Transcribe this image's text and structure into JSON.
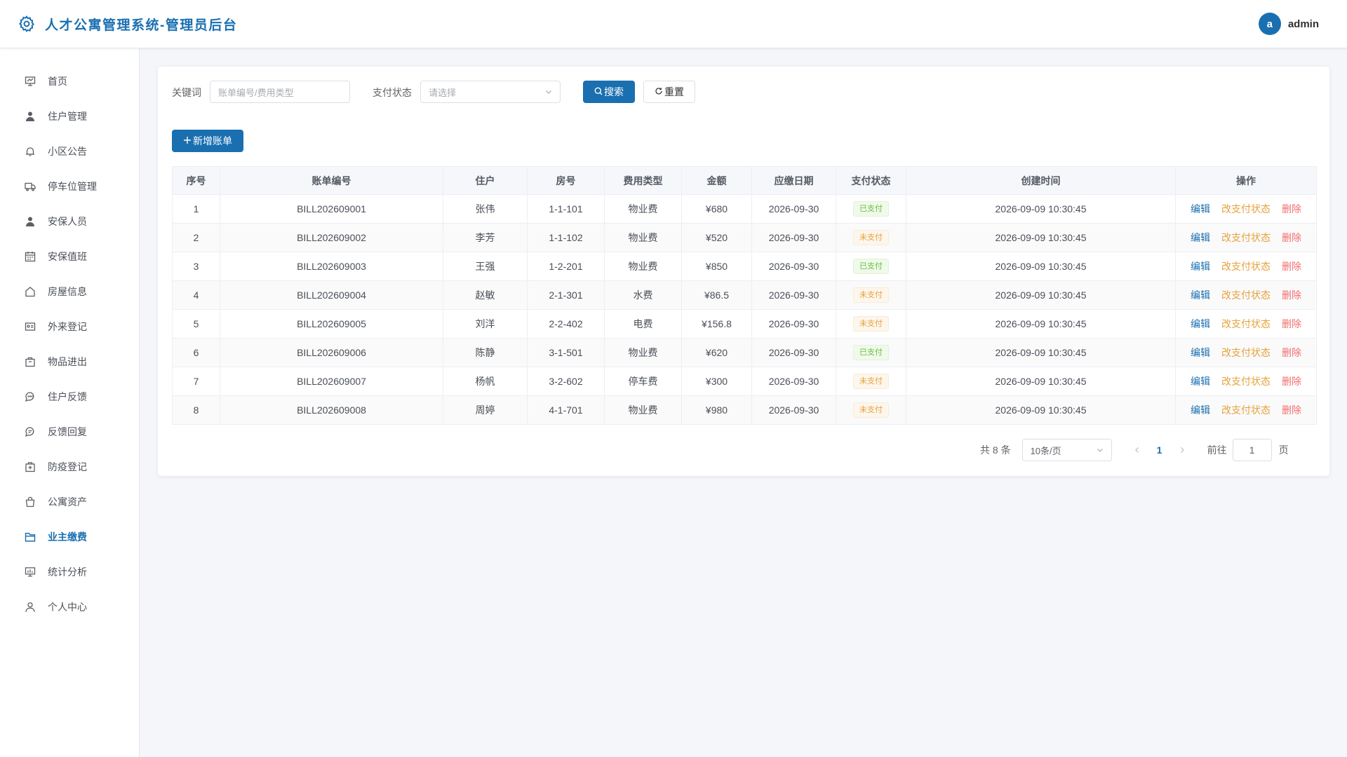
{
  "header": {
    "title": "人才公寓管理系统-管理员后台",
    "avatar_letter": "a",
    "username": "admin",
    "icon": "gear-icon"
  },
  "sidebar": {
    "items": [
      {
        "label": "首页",
        "icon": "dashboard-icon"
      },
      {
        "label": "住户管理",
        "icon": "user-icon"
      },
      {
        "label": "小区公告",
        "icon": "bell-icon"
      },
      {
        "label": "停车位管理",
        "icon": "truck-icon"
      },
      {
        "label": "安保人员",
        "icon": "person-icon"
      },
      {
        "label": "安保值班",
        "icon": "calendar-icon"
      },
      {
        "label": "房屋信息",
        "icon": "house-icon"
      },
      {
        "label": "外来登记",
        "icon": "id-card-icon"
      },
      {
        "label": "物品进出",
        "icon": "box-icon"
      },
      {
        "label": "住户反馈",
        "icon": "chat-icon"
      },
      {
        "label": "反馈回复",
        "icon": "chat-reply-icon"
      },
      {
        "label": "防疫登记",
        "icon": "first-aid-icon"
      },
      {
        "label": "公寓资产",
        "icon": "bag-icon"
      },
      {
        "label": "业主缴费",
        "icon": "folder-icon",
        "active": true
      },
      {
        "label": "统计分析",
        "icon": "chart-icon"
      },
      {
        "label": "个人中心",
        "icon": "user-outline-icon"
      }
    ]
  },
  "filters": {
    "keyword_label": "关键词",
    "keyword_placeholder": "账单编号/费用类型",
    "status_label": "支付状态",
    "status_placeholder": "请选择",
    "search_label": "搜索",
    "reset_label": "重置"
  },
  "toolbar": {
    "add_label": "新增账单"
  },
  "table": {
    "columns": [
      "序号",
      "账单编号",
      "住户",
      "房号",
      "费用类型",
      "金额",
      "应缴日期",
      "支付状态",
      "创建时间",
      "操作"
    ],
    "rows": [
      {
        "idx": "1",
        "bill": "BILL202609001",
        "resident": "张伟",
        "room": "1-1-101",
        "fee_type": "物业费",
        "amount": "¥680",
        "due": "2026-09-30",
        "status": "已支付",
        "paid": true,
        "created": "2026-09-09 10:30:45"
      },
      {
        "idx": "2",
        "bill": "BILL202609002",
        "resident": "李芳",
        "room": "1-1-102",
        "fee_type": "物业费",
        "amount": "¥520",
        "due": "2026-09-30",
        "status": "未支付",
        "paid": false,
        "created": "2026-09-09 10:30:45"
      },
      {
        "idx": "3",
        "bill": "BILL202609003",
        "resident": "王强",
        "room": "1-2-201",
        "fee_type": "物业费",
        "amount": "¥850",
        "due": "2026-09-30",
        "status": "已支付",
        "paid": true,
        "created": "2026-09-09 10:30:45"
      },
      {
        "idx": "4",
        "bill": "BILL202609004",
        "resident": "赵敏",
        "room": "2-1-301",
        "fee_type": "水费",
        "amount": "¥86.5",
        "due": "2026-09-30",
        "status": "未支付",
        "paid": false,
        "created": "2026-09-09 10:30:45"
      },
      {
        "idx": "5",
        "bill": "BILL202609005",
        "resident": "刘洋",
        "room": "2-2-402",
        "fee_type": "电费",
        "amount": "¥156.8",
        "due": "2026-09-30",
        "status": "未支付",
        "paid": false,
        "created": "2026-09-09 10:30:45"
      },
      {
        "idx": "6",
        "bill": "BILL202609006",
        "resident": "陈静",
        "room": "3-1-501",
        "fee_type": "物业费",
        "amount": "¥620",
        "due": "2026-09-30",
        "status": "已支付",
        "paid": true,
        "created": "2026-09-09 10:30:45"
      },
      {
        "idx": "7",
        "bill": "BILL202609007",
        "resident": "杨帆",
        "room": "3-2-602",
        "fee_type": "停车费",
        "amount": "¥300",
        "due": "2026-09-30",
        "status": "未支付",
        "paid": false,
        "created": "2026-09-09 10:30:45"
      },
      {
        "idx": "8",
        "bill": "BILL202609008",
        "resident": "周婷",
        "room": "4-1-701",
        "fee_type": "物业费",
        "amount": "¥980",
        "due": "2026-09-30",
        "status": "未支付",
        "paid": false,
        "created": "2026-09-09 10:30:45"
      }
    ],
    "actions": {
      "edit": "编辑",
      "change_status": "改支付状态",
      "delete": "删除"
    }
  },
  "pagination": {
    "total": "共 8 条",
    "page_size": "10条/页",
    "current_page": "1",
    "goto_label": "前往",
    "goto_value": "1",
    "page_suffix": "页"
  },
  "colors": {
    "primary": "#1a6fb0",
    "paid": "#67c23a",
    "unpaid": "#e6a23c",
    "danger": "#f56c6c"
  }
}
